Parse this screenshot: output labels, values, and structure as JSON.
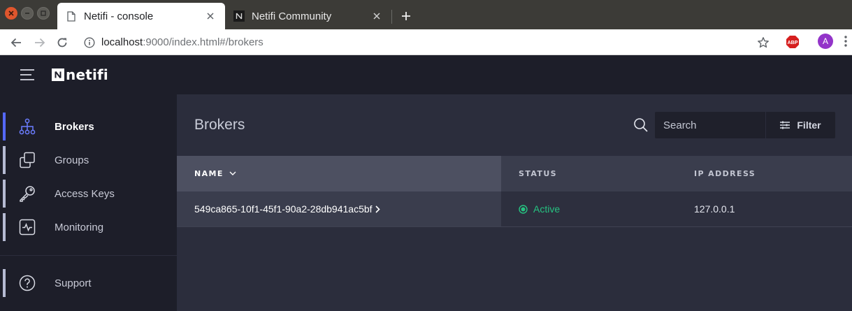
{
  "browser": {
    "tabs": [
      {
        "title": "Netifi - console",
        "active": true
      },
      {
        "title": "Netifi Community",
        "active": false
      }
    ],
    "address": {
      "host": "localhost",
      "rest": ":9000/index.html#/brokers"
    },
    "abp_label": "ABP",
    "profile_initial": "A"
  },
  "app": {
    "logo_text": "netifi",
    "sidebar": {
      "items": [
        {
          "label": "Brokers",
          "icon": "network-tree-icon",
          "active": true
        },
        {
          "label": "Groups",
          "icon": "groups-squares-icon",
          "active": false
        },
        {
          "label": "Access Keys",
          "icon": "key-icon",
          "active": false
        },
        {
          "label": "Monitoring",
          "icon": "pulse-monitor-icon",
          "active": false
        }
      ],
      "support": {
        "label": "Support",
        "icon": "help-circle-icon"
      }
    },
    "main": {
      "title": "Brokers",
      "search": {
        "placeholder": "Search"
      },
      "filter_label": "Filter",
      "table": {
        "columns": [
          "NAME",
          "STATUS",
          "IP ADDRESS"
        ],
        "rows": [
          {
            "name": "549ca865-10f1-45f1-90a2-28db941ac5bf",
            "status": "Active",
            "ip": "127.0.0.1"
          }
        ]
      }
    },
    "colors": {
      "accent": "#5468ff",
      "active_status": "#26c281",
      "header_bg": "#1d1e29",
      "content_bg": "#2b2d3c"
    }
  }
}
